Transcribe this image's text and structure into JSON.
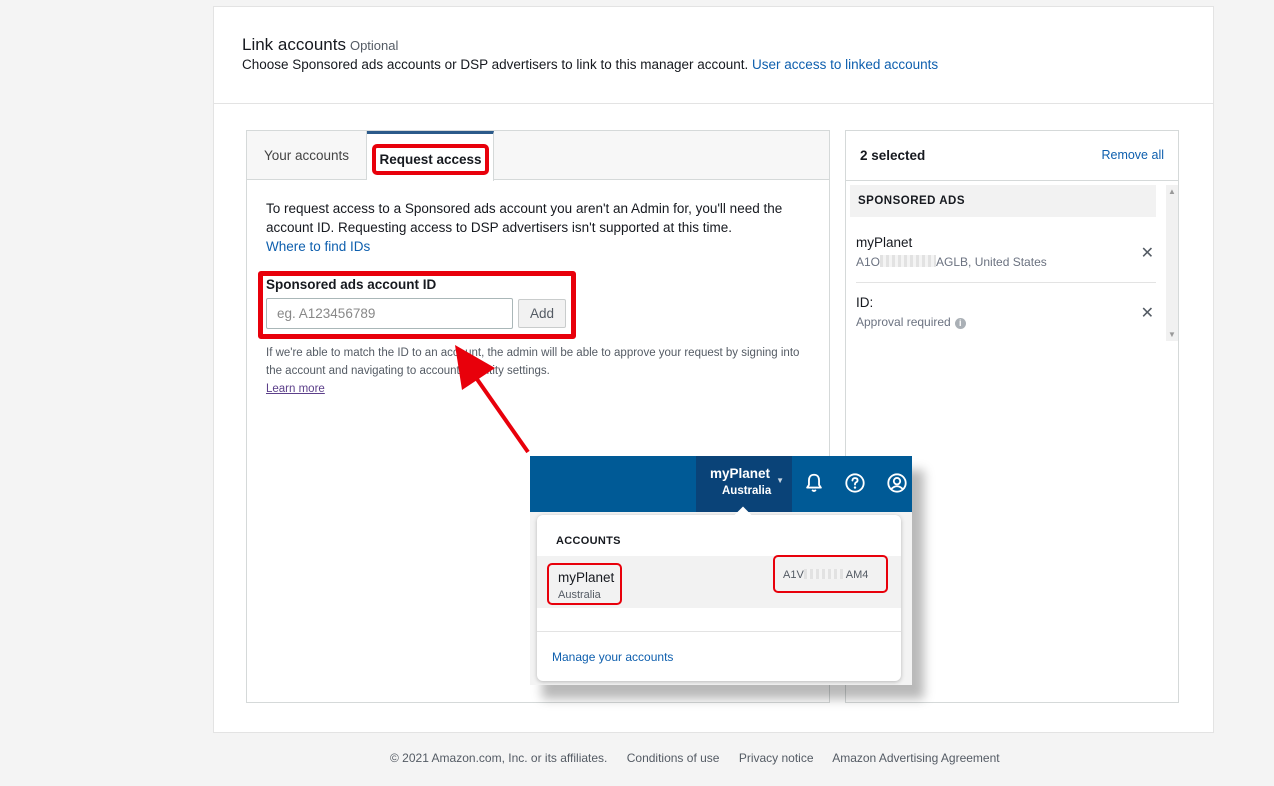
{
  "header": {
    "title": "Link accounts",
    "optional": "Optional",
    "description": "Choose Sponsored ads accounts or DSP advertisers to link to this manager account.",
    "link": "User access to linked accounts"
  },
  "tabs": [
    "Your accounts",
    "Request access"
  ],
  "request_access": {
    "intro": "To request access to a Sponsored ads account you aren't an Admin for, you'll need the account ID. Requesting access to DSP advertisers isn't supported at this time.",
    "find_ids_link": "Where to find IDs",
    "field_label": "Sponsored ads account ID",
    "placeholder": "eg. A123456789",
    "add_button": "Add",
    "help": "If we're able to match the ID to an account, the admin will be able to approve your request by signing into the account and navigating to account or entity settings.",
    "learn_more": "Learn more"
  },
  "selected_panel": {
    "count_label": "2 selected",
    "remove_all": "Remove all",
    "section": "SPONSORED ADS",
    "items": [
      {
        "name": "myPlanet",
        "id_prefix": "A1O",
        "id_suffix": "AGLB, United States"
      },
      {
        "name": "ID:",
        "status": "Approval required"
      }
    ]
  },
  "inset": {
    "account_name": "myPlanet",
    "account_location": "Australia",
    "accounts_heading": "ACCOUNTS",
    "row_name": "myPlanet",
    "row_location": "Australia",
    "row_id_prefix": "A1V",
    "row_id_suffix": "AM4",
    "manage_link": "Manage your accounts"
  },
  "footer": {
    "copyright": "© 2021 Amazon.com, Inc. or its affiliates.",
    "links": [
      "Conditions of use",
      "Privacy notice",
      "Amazon Advertising Agreement"
    ]
  },
  "colors": {
    "highlight": "#e8000b",
    "link": "#0e5fae",
    "topbar": "#005a96"
  }
}
